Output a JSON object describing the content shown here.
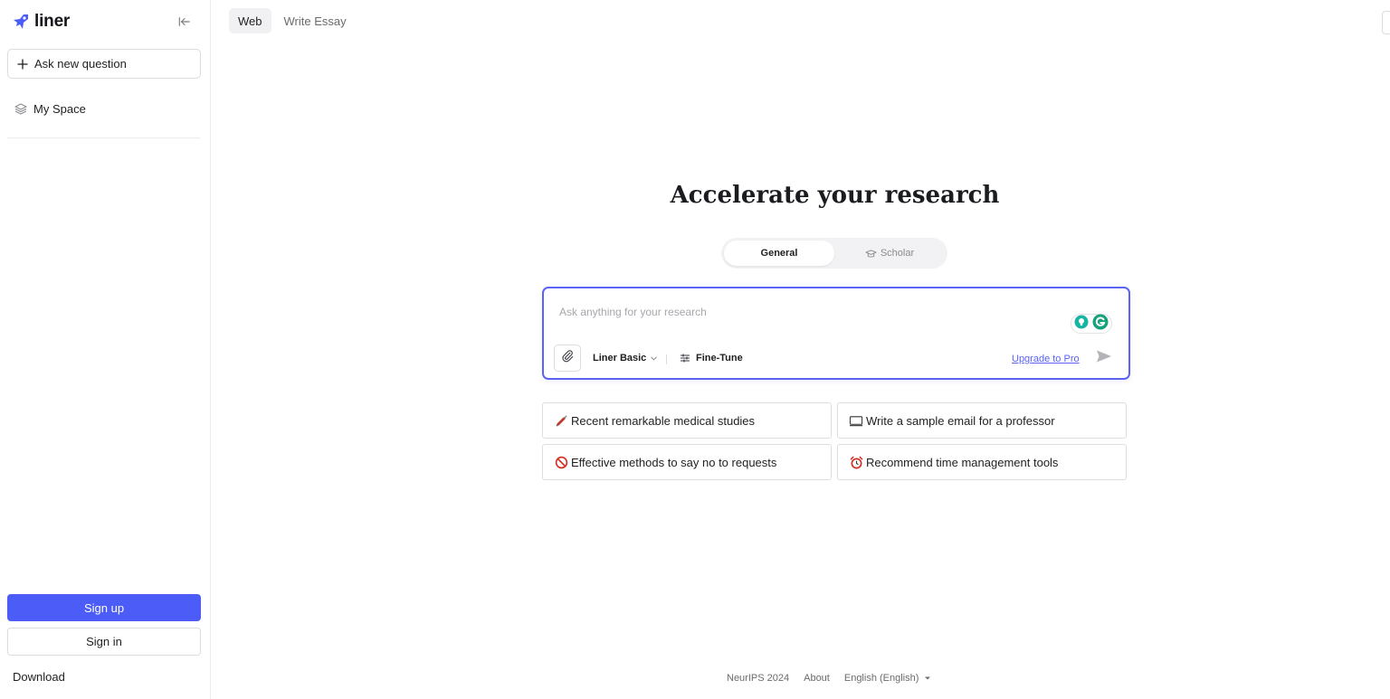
{
  "app": {
    "brand": "liner",
    "accent_color": "#4c5cf7"
  },
  "sidebar": {
    "ask_new_question": "Ask new question",
    "my_space": "My Space",
    "sign_up": "Sign up",
    "sign_in": "Sign in",
    "download": "Download"
  },
  "tabs": {
    "web": "Web",
    "write_essay": "Write Essay"
  },
  "hero": {
    "headline": "Accelerate your research",
    "mode_general": "General",
    "mode_scholar": "Scholar"
  },
  "search": {
    "placeholder": "Ask anything for your research",
    "model": "Liner Basic",
    "fine_tune": "Fine-Tune",
    "upgrade": "Upgrade to Pro"
  },
  "suggestions": [
    {
      "emoji": "syringe-icon",
      "text": "Recent remarkable medical studies"
    },
    {
      "emoji": "laptop-icon",
      "text": "Write a sample email for a professor"
    },
    {
      "emoji": "no-entry-icon",
      "text": "Effective methods to say no to requests"
    },
    {
      "emoji": "alarm-clock-icon",
      "text": "Recommend time management tools"
    }
  ],
  "footer": {
    "event": "NeurIPS 2024",
    "about": "About",
    "language": "English (English)"
  }
}
